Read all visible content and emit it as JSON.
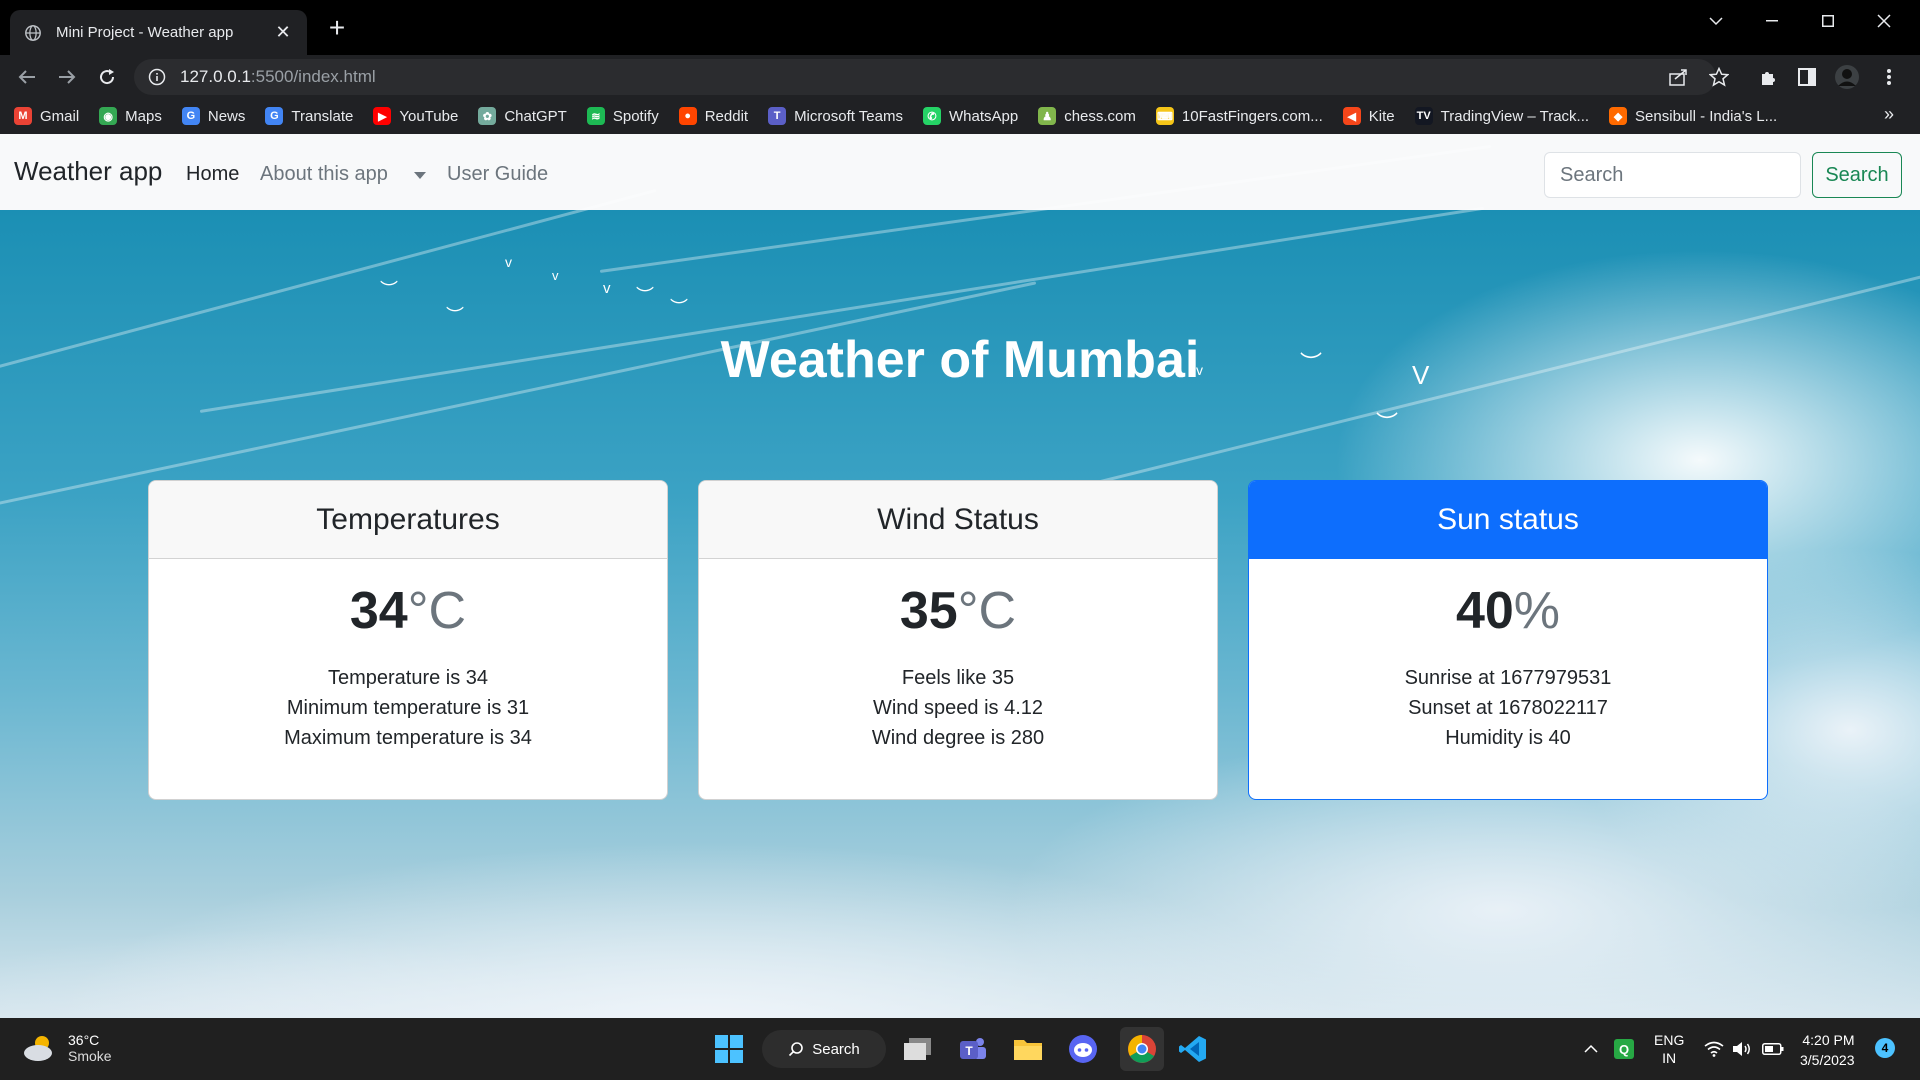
{
  "browser": {
    "tab_title": "Mini Project - Weather app",
    "url_host": "127.0.0.1",
    "url_path": ":5500/index.html",
    "bookmarks": [
      {
        "label": "Gmail",
        "icon": "gmail-icon",
        "color": "#ea4335"
      },
      {
        "label": "Maps",
        "icon": "maps-icon",
        "color": "#34a853"
      },
      {
        "label": "News",
        "icon": "news-icon",
        "color": "#4285f4"
      },
      {
        "label": "Translate",
        "icon": "translate-icon",
        "color": "#4285f4"
      },
      {
        "label": "YouTube",
        "icon": "youtube-icon",
        "color": "#ff0000"
      },
      {
        "label": "ChatGPT",
        "icon": "chatgpt-icon",
        "color": "#74aa9c"
      },
      {
        "label": "Spotify",
        "icon": "spotify-icon",
        "color": "#1db954"
      },
      {
        "label": "Reddit",
        "icon": "reddit-icon",
        "color": "#ff4500"
      },
      {
        "label": "Microsoft Teams",
        "icon": "teams-icon",
        "color": "#5b5fc7"
      },
      {
        "label": "WhatsApp",
        "icon": "whatsapp-icon",
        "color": "#25d366"
      },
      {
        "label": "chess.com",
        "icon": "chess-icon",
        "color": "#81b64c"
      },
      {
        "label": "10FastFingers.com...",
        "icon": "fastfingers-icon",
        "color": "#f5c518"
      },
      {
        "label": "Kite",
        "icon": "kite-icon",
        "color": "#f6461a"
      },
      {
        "label": "TradingView – Track...",
        "icon": "tradingview-icon",
        "color": "#131722"
      },
      {
        "label": "Sensibull - India's L...",
        "icon": "sensibull-icon",
        "color": "#ff6a00"
      }
    ]
  },
  "site": {
    "brand": "Weather app",
    "nav": [
      "Home",
      "About this app",
      "User Guide"
    ],
    "search_placeholder": "Search",
    "search_button": "Search"
  },
  "hero": {
    "title": "Weather of Mumbai"
  },
  "cards": [
    {
      "header": "Temperatures",
      "value": "34",
      "unit": "°C",
      "lines": [
        "Temperature is 34",
        "Minimum temperature is 31",
        "Maximum temperature is 34"
      ]
    },
    {
      "header": "Wind Status",
      "value": "35",
      "unit": "°C",
      "lines": [
        "Feels like 35",
        "Wind speed is 4.12",
        "Wind degree is 280"
      ]
    },
    {
      "header": "Sun status",
      "value": "40",
      "unit": "%",
      "lines": [
        "Sunrise at 1677979531",
        "Sunset at 1678022117",
        "Humidity is 40"
      ]
    }
  ],
  "taskbar": {
    "weather_temp": "36°C",
    "weather_cond": "Smoke",
    "search_label": "Search",
    "lang_top": "ENG",
    "lang_bottom": "IN",
    "time": "4:20 PM",
    "date": "3/5/2023",
    "notification_count": "4"
  },
  "colors": {
    "primary": "#0d6efd",
    "success": "#198754"
  }
}
